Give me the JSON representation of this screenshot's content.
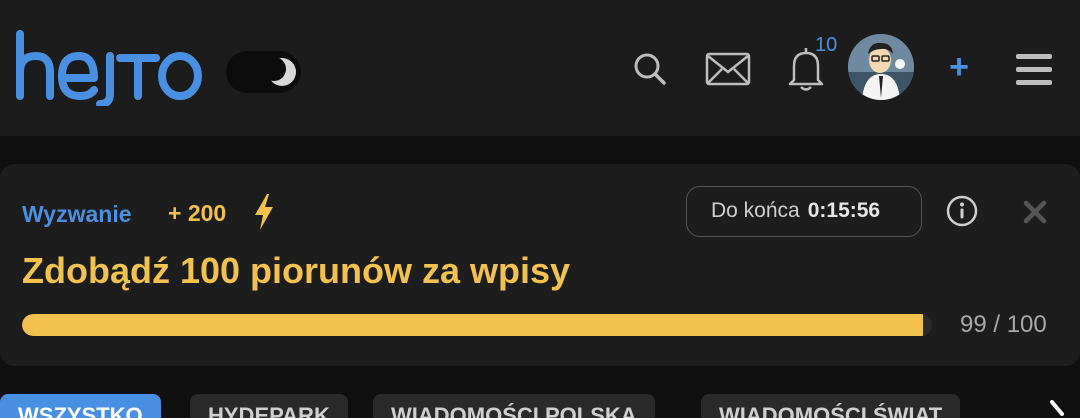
{
  "header": {
    "logo_text": "hejto",
    "notifications_count": "10",
    "add_label": "+"
  },
  "colors": {
    "accent_blue": "#4a90e2",
    "accent_yellow": "#f2c14e",
    "background": "#101010",
    "surface": "#1d1d1d"
  },
  "icons": {
    "search": "search-icon",
    "messages": "mail-icon",
    "notifications": "bell-icon",
    "menu": "hamburger-menu-icon",
    "theme": "moon-icon",
    "bolt": "lightning-bolt-icon",
    "info": "info-icon",
    "close": "close-icon"
  },
  "challenge": {
    "label": "Wyzwanie",
    "points": "+ 200",
    "timer_label": "Do końca",
    "timer_value": "0:15:56",
    "title": "Zdobądź 100 piorunów za wpisy",
    "progress_text": "99 / 100",
    "progress_fraction": 0.99
  },
  "tabs": [
    {
      "label": "WSZYSTKO",
      "active": true
    },
    {
      "label": "HYDEPARK",
      "active": false
    },
    {
      "label": "WIADOMOŚCI POLSKA",
      "active": false
    },
    {
      "label": "WIADOMOŚCI ŚWIAT",
      "active": false
    }
  ]
}
